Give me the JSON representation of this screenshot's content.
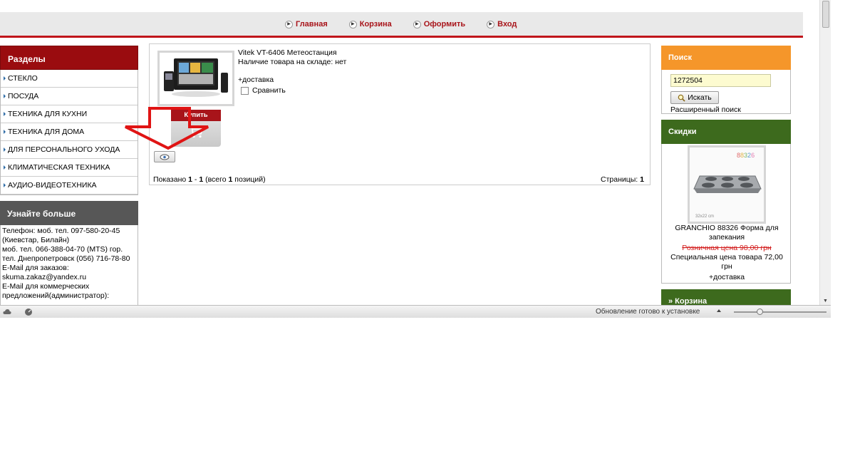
{
  "topnav": {
    "items": [
      {
        "label": "Главная"
      },
      {
        "label": "Корзина"
      },
      {
        "label": "Оформить"
      },
      {
        "label": "Вход"
      }
    ]
  },
  "sections": {
    "title": "Разделы",
    "items": [
      "СТЕКЛО",
      "ПОСУДА",
      "ТЕХНИКА ДЛЯ КУХНИ",
      "ТЕХНИКА ДЛЯ ДОМА",
      "ДЛЯ ПЕРСОНАЛЬНОГО УХОДА",
      "КЛИМАТИЧЕСКАЯ ТЕХНИКА",
      "АУДИО-ВИДЕОТЕХНИКА"
    ]
  },
  "learn_more": {
    "title": "Узнайте больше",
    "lines": [
      "Телефон: моб. тел. 097-580-20-45",
      "(Киевстар, Билайн)",
      "моб. тел. 066-388-04-70 (MTS) гор.",
      "тел. Днепропетровск (056) 716-78-80",
      "E-Mail для заказов:",
      "skuma.zakaz@yandex.ru",
      "E-Mail для коммерческих",
      "предложений(администратор):"
    ]
  },
  "product": {
    "name": "Vitek VT-6406 Метеостанция",
    "stock": "Наличие товара на складе: нет",
    "delivery": "+доставка",
    "compare": "Сравнить",
    "buy": "Купить"
  },
  "listing": {
    "shown_prefix": "Показано ",
    "shown_from": "1",
    "shown_sep": " - ",
    "shown_to": "1",
    "shown_total_prefix": " (всего ",
    "shown_total": "1",
    "shown_suffix": " позиций)",
    "pages_label": "Страницы: ",
    "page": "1"
  },
  "search": {
    "title": "Поиск",
    "value": "1272504",
    "button": "Искать",
    "advanced": "Расширенный поиск"
  },
  "discounts": {
    "title": "Скидки",
    "badge": "88326",
    "img_caption": "32x22 cm",
    "name": "GRANCHIO 88326 Форма для запекания",
    "old_price": "Розничная цена 98,00 грн",
    "special_price": "Специальная цена товара 72,00 грн",
    "delivery": "+доставка"
  },
  "cart_box": {
    "title": "» Корзина"
  },
  "statusbar": {
    "update": "Обновление готово к установке"
  },
  "colors": {
    "brand_red": "#a8141a",
    "section_red": "#9a0c0f",
    "search_orange": "#f5962a",
    "green": "#3d6a1d"
  }
}
